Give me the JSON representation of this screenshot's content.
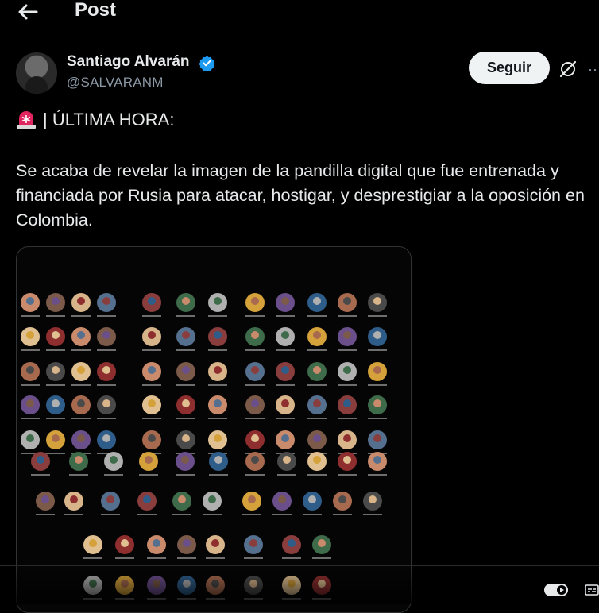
{
  "header": {
    "title": "Post"
  },
  "author": {
    "name": "Santiago Alvarán",
    "handle": "@SALVARANM"
  },
  "actions": {
    "follow_label": "Seguir",
    "more_label": "··"
  },
  "post": {
    "alert": "| ÚLTIMA HORA:",
    "text": "Se acaba de revelar la imagen de la pandilla digital que fue entrenada y financiada por Rusia para atacar, hostigar, y desprestigiar a la oposición en Colombia."
  },
  "colors": {
    "verified": "#1d9bf0",
    "follow_bg": "#eff3f4",
    "siren": "#e0245e"
  },
  "icons": [
    "back-arrow-icon",
    "verified-badge-icon",
    "grok-icon",
    "siren-icon",
    "play-toggle-icon",
    "captions-icon"
  ]
}
